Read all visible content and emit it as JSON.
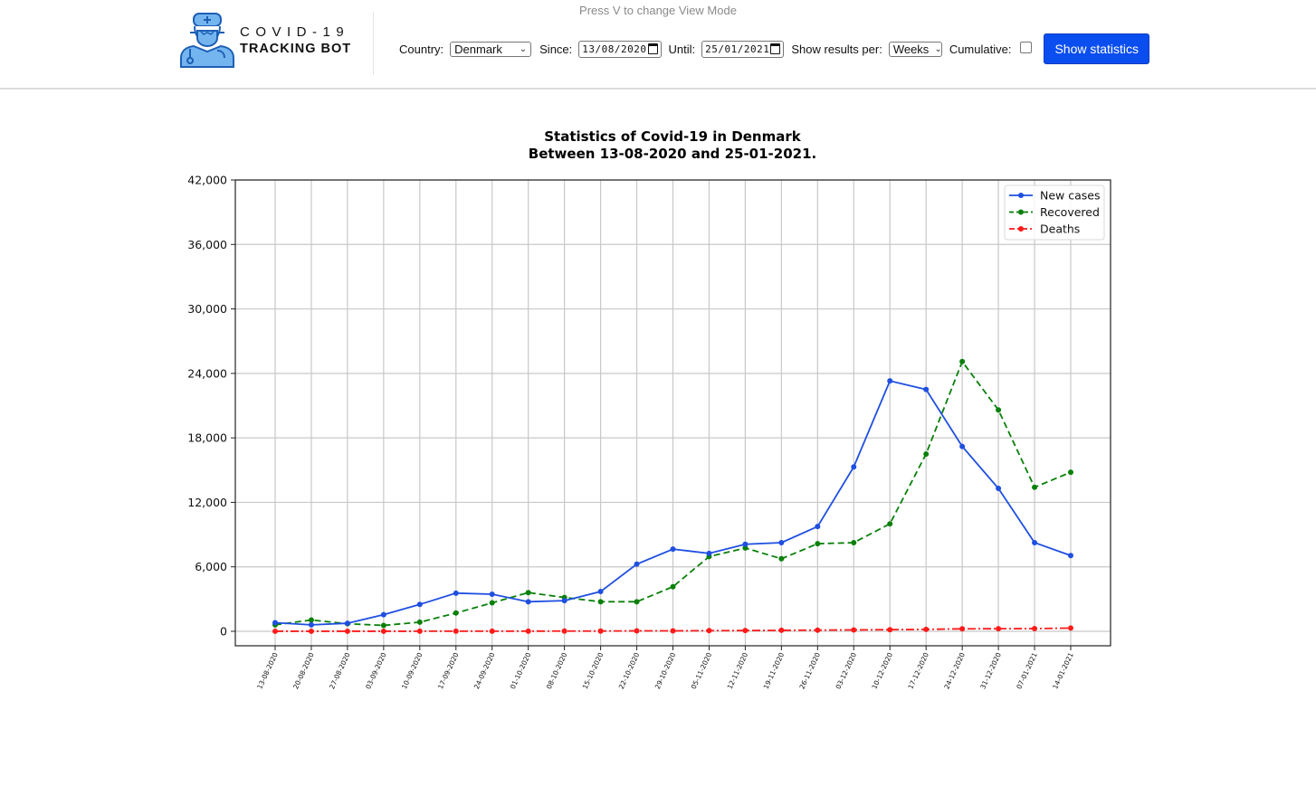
{
  "header": {
    "hint": "Press V to change View Mode",
    "brand_line1": "COVID-19",
    "brand_line2": "TRACKING BOT",
    "logo_icon": "doctor-mask-icon"
  },
  "controls": {
    "country_label": "Country:",
    "country_value": "Denmark",
    "since_label": "Since:",
    "since_value": "13/08/2020",
    "until_label": "Until:",
    "until_value": "25/01/2021",
    "per_label": "Show results per:",
    "per_value": "Weeks",
    "cumulative_label": "Cumulative:",
    "cumulative_checked": false,
    "submit_label": "Show statistics",
    "accent_color": "#0a4ef0"
  },
  "chart_data": {
    "type": "line",
    "title_line1": "Statistics of Covid-19 in Denmark",
    "title_line2": "Between 13-08-2020 and 25-01-2021.",
    "xlabel": "",
    "ylabel": "",
    "ylim": [
      -1350,
      42000
    ],
    "yticks": [
      0,
      6000,
      12000,
      18000,
      24000,
      30000,
      36000,
      42000
    ],
    "ytick_labels": [
      "0",
      "6,000",
      "12,000",
      "18,000",
      "24,000",
      "30,000",
      "36,000",
      "42,000"
    ],
    "grid": true,
    "legend_position": "top-right",
    "categories": [
      "13-08-2020",
      "20-08-2020",
      "27-08-2020",
      "03-09-2020",
      "10-09-2020",
      "17-09-2020",
      "24-09-2020",
      "01-10-2020",
      "08-10-2020",
      "15-10-2020",
      "22-10-2020",
      "29-10-2020",
      "05-11-2020",
      "12-11-2020",
      "19-11-2020",
      "26-11-2020",
      "03-12-2020",
      "10-12-2020",
      "17-12-2020",
      "24-12-2020",
      "31-12-2020",
      "07-01-2021",
      "14-01-2021"
    ],
    "series": [
      {
        "name": "New cases",
        "color": "#1f4fe0",
        "style": "solid",
        "values": [
          800,
          600,
          750,
          1550,
          2500,
          3550,
          3450,
          2750,
          2850,
          3700,
          6250,
          7650,
          7250,
          8100,
          8250,
          9750,
          15300,
          23300,
          22500,
          17200,
          13300,
          8250,
          7050
        ]
      },
      {
        "name": "Recovered",
        "color": "#0a800a",
        "style": "dashed",
        "values": [
          600,
          1050,
          700,
          550,
          850,
          1700,
          2650,
          3600,
          3150,
          2750,
          2750,
          4150,
          6950,
          7750,
          6750,
          8150,
          8250,
          10000,
          16500,
          25100,
          20600,
          13400,
          14800
        ]
      },
      {
        "name": "Deaths",
        "color": "#ff1a1a",
        "style": "dashdot",
        "values": [
          5,
          5,
          5,
          5,
          8,
          10,
          12,
          15,
          20,
          25,
          40,
          40,
          60,
          70,
          90,
          110,
          130,
          150,
          180,
          230,
          240,
          250,
          300
        ]
      }
    ]
  }
}
